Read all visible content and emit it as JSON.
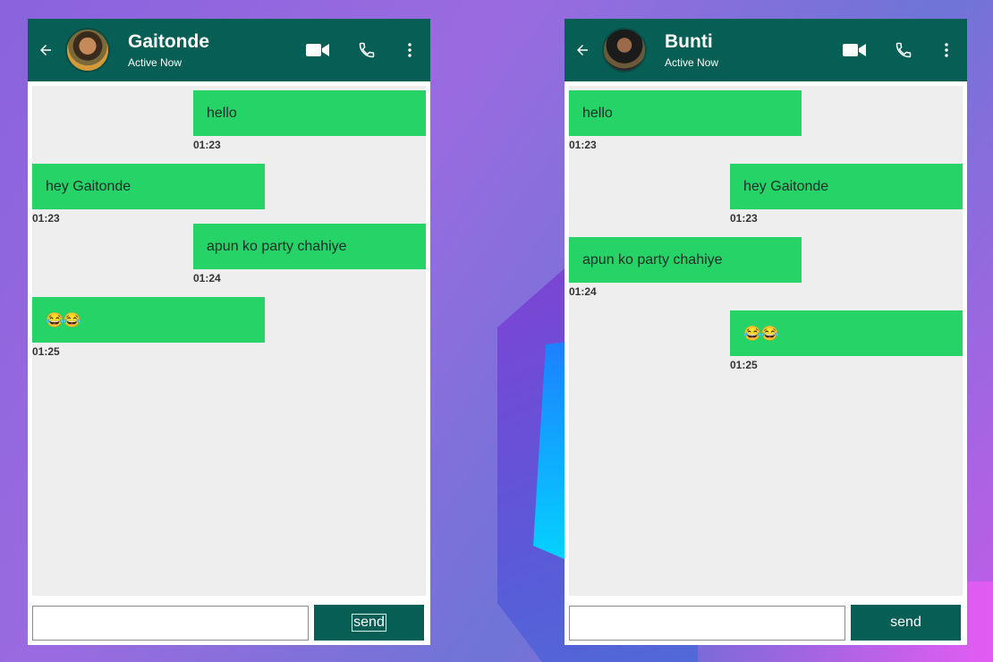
{
  "left_panel": {
    "contact_name": "Gaitonde",
    "contact_status": "Active Now",
    "messages": [
      {
        "direction": "out",
        "text": "hello",
        "time": "01:23"
      },
      {
        "direction": "in",
        "text": "hey Gaitonde",
        "time": "01:23"
      },
      {
        "direction": "out",
        "text": "apun ko party chahiye",
        "time": "01:24"
      },
      {
        "direction": "in",
        "text": "😂😂",
        "time": "01:25"
      }
    ],
    "input_value": "",
    "send_label": "send"
  },
  "right_panel": {
    "contact_name": "Bunti",
    "contact_status": "Active Now",
    "messages": [
      {
        "direction": "in",
        "text": "hello",
        "time": "01:23"
      },
      {
        "direction": "out",
        "text": "hey Gaitonde",
        "time": "01:23"
      },
      {
        "direction": "in",
        "text": "apun ko party chahiye",
        "time": "01:24"
      },
      {
        "direction": "out",
        "text": "😂😂",
        "time": "01:25"
      }
    ],
    "input_value": "",
    "send_label": "send"
  },
  "icons": {
    "back": "arrow-left-icon",
    "video": "video-camera-icon",
    "call": "phone-icon",
    "more": "more-vertical-icon"
  },
  "colors": {
    "header": "#075e54",
    "bubble": "#25d366",
    "chat_bg": "#eeeeee",
    "send_button": "#075e54"
  }
}
